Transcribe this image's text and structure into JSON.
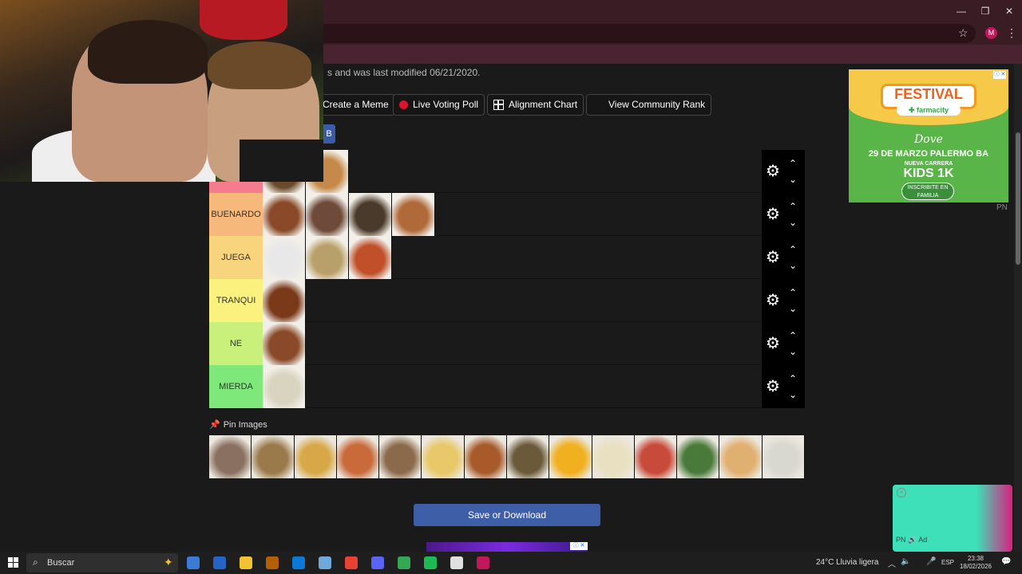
{
  "window": {
    "minimize": "—",
    "restore": "❐",
    "close": "✕",
    "profile_initial": "M"
  },
  "page": {
    "modified_text": "s and was last modified 06/21/2020.",
    "toolbar": [
      {
        "label": "Create a Meme",
        "icon": "none"
      },
      {
        "label": "Live Voting Poll",
        "icon": "red-dot-icon"
      },
      {
        "label": "Alignment Chart",
        "icon": "grid-icon"
      },
      {
        "label": "View Community Rank",
        "icon": "rank-grid-icon"
      }
    ],
    "tag_b": "B",
    "tiers": [
      {
        "label": "",
        "color": "#f47c8c",
        "items": [
          "#6b4a2a",
          "#c58a4a"
        ]
      },
      {
        "label": "BUENARDO",
        "color": "#f6b97b",
        "items": [
          "#8a4a2a",
          "#6e4a3a",
          "#4a3a2a",
          "#b06a3a"
        ]
      },
      {
        "label": "JUEGA",
        "color": "#f8d57c",
        "items": [
          "#e8e8e8",
          "#b9a06a",
          "#c0502a"
        ]
      },
      {
        "label": "TRANQUI",
        "color": "#fbf17f",
        "items": [
          "#7a3a1a"
        ]
      },
      {
        "label": "NE",
        "color": "#c9f07a",
        "items": [
          "#8a4a2a"
        ]
      },
      {
        "label": "MIERDA",
        "color": "#7fe87a",
        "items": [
          "#d8d4c0"
        ]
      }
    ],
    "pin_label": "Pin Images",
    "pool_items": [
      "#8a7060",
      "#9a7a4a",
      "#d8a848",
      "#c86a3a",
      "#8a6a4a",
      "#e8c868",
      "#a85a2a",
      "#6a5a3a",
      "#f0b020",
      "#e8e0c0",
      "#c84a3a",
      "#4a7a3a",
      "#e0b070",
      "#d8d8d0"
    ],
    "save_label": "Save or Download",
    "bottom_ad_close": "ⓘ ✕"
  },
  "ads": {
    "festival_title": "FESTIVAL",
    "festival_sub": "✚ farmacity",
    "brand": "Dove",
    "line1": "29 DE MARZO PALERMO BA",
    "line2": "NUEVA CARRERA",
    "line3": "KIDS 1K",
    "cta": "INSCRIBITE EN FAMILIA",
    "info": "ⓘ ✕",
    "pn": "PN",
    "video_close": "×",
    "video_controls": "PN  🔊  Ad"
  },
  "taskbar": {
    "search_placeholder": "Buscar",
    "weather": "24°C  Lluvia ligera",
    "language": "ESP",
    "time": "23:38",
    "date": "18/02/2026",
    "pinned_colors": [
      "#3a7bd5",
      "#2564c4",
      "#f1c232",
      "#b45f06",
      "#0b7ad6",
      "#6fa8dc",
      "#e94235",
      "#5865f2",
      "#34a853",
      "#1db954",
      "#e0e0e0",
      "#c2185b"
    ]
  }
}
